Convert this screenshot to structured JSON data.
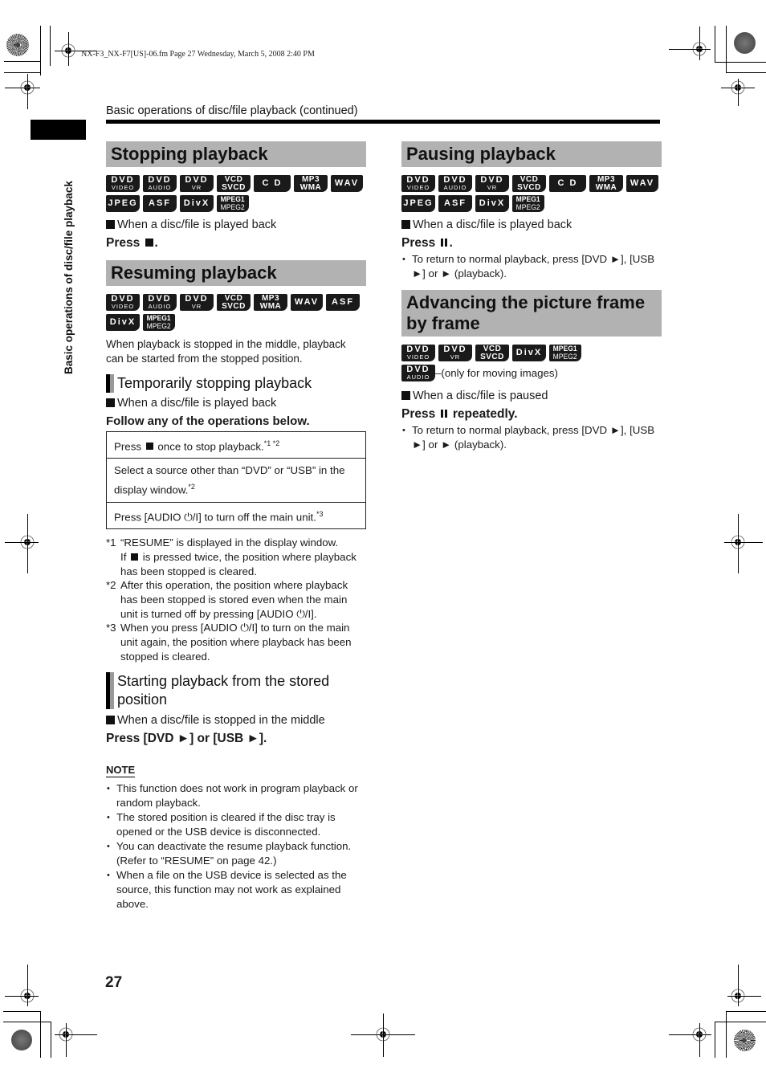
{
  "file_info": "NX-F3_NX-F7[US]-06.fm  Page 27  Wednesday, March 5, 2008  2:40 PM",
  "running_head": "Basic operations of disc/file playback (continued)",
  "side_label": "Basic operations of disc/file playback",
  "page_number": "27",
  "badge_types": {
    "dvd_video": {
      "t1": "DVD",
      "t2": "VIDEO"
    },
    "dvd_audio": {
      "t1": "DVD",
      "t2": "AUDIO"
    },
    "dvd_vr": {
      "t1": "DVD",
      "t2": "VR"
    },
    "vcd_svcd": {
      "t1": "VCD",
      "t2": "SVCD"
    },
    "cd": {
      "t1": "C D"
    },
    "mp3_wma": {
      "t1": "MP3",
      "t2": "WMA"
    },
    "wav": {
      "t1": "WAV"
    },
    "jpeg": {
      "t1": "JPEG"
    },
    "asf": {
      "t1": "ASF"
    },
    "divx": {
      "t1": "DivX"
    },
    "mpeg": {
      "t1": "MPEG1",
      "t2": "MPEG2"
    }
  },
  "stopping": {
    "title": "Stopping playback",
    "badges": [
      "DVD VIDEO",
      "DVD AUDIO",
      "DVD VR",
      "VCD SVCD",
      "CD",
      "MP3 WMA",
      "WAV",
      "JPEG",
      "ASF",
      "DivX",
      "MPEG1 MPEG2"
    ],
    "condition": "When a disc/file is played back",
    "press_prefix": "Press",
    "press_suffix": ".",
    "press_icon": "stop-icon"
  },
  "resuming": {
    "title": "Resuming playback",
    "badges": [
      "DVD VIDEO",
      "DVD AUDIO",
      "DVD VR",
      "VCD SVCD",
      "MP3 WMA",
      "WAV",
      "ASF",
      "DivX",
      "MPEG1 MPEG2"
    ],
    "intro": "When playback is stopped in the middle, playback can be started from the stopped position.",
    "temp_stop": {
      "heading": "Temporarily stopping playback",
      "condition": "When a disc/file is played back",
      "instruction": "Follow any of the operations below.",
      "ops": [
        {
          "pre": "Press",
          "post": "once to stop playback.",
          "sup": "*1 *2"
        },
        {
          "text": "Select a source other than “DVD” or “USB” in the display window.",
          "sup": "*2"
        },
        {
          "text": "Press [AUDIO ⏻/I] to turn off the main unit.",
          "sup": "*3"
        }
      ],
      "footnotes": [
        {
          "mark": "*1",
          "line1": "“RESUME” is displayed in the display window.",
          "line2_pre": "If",
          "line2_post": "is pressed twice, the position where playback has been stopped is cleared."
        },
        {
          "mark": "*2",
          "text": "After this operation, the position where playback has been stopped is stored even when the main unit is turned off by pressing [AUDIO ⏻/I]."
        },
        {
          "mark": "*3",
          "text": "When you press [AUDIO ⏻/I] to turn on the main unit again, the position where playback has been stopped is cleared."
        }
      ]
    },
    "start_stored": {
      "heading": "Starting playback from the stored position",
      "condition": "When a disc/file is stopped in the middle",
      "press": "Press [DVD ►] or [USB ►]."
    },
    "note": {
      "heading": "NOTE",
      "items": [
        "This function does not work in program playback or random playback.",
        "The stored position is cleared if the disc tray is opened or the USB device is disconnected.",
        "You can deactivate the resume playback function. (Refer to “RESUME” on page 42.)",
        "When a file on the USB device is selected as the source, this function may not work as explained above."
      ]
    }
  },
  "pausing": {
    "title": "Pausing playback",
    "badges": [
      "DVD VIDEO",
      "DVD AUDIO",
      "DVD VR",
      "VCD SVCD",
      "CD",
      "MP3 WMA",
      "WAV",
      "JPEG",
      "ASF",
      "DivX",
      "MPEG1 MPEG2"
    ],
    "condition": "When a disc/file is played back",
    "press_prefix": "Press",
    "press_suffix": ".",
    "press_icon": "pause-icon",
    "bullet": "To return to normal playback, press [DVD ►], [USB ►] or ► (playback)."
  },
  "advancing": {
    "title": "Advancing the picture frame by frame",
    "badges": [
      "DVD VIDEO",
      "DVD VR",
      "VCD SVCD",
      "DivX",
      "MPEG1 MPEG2"
    ],
    "extra_badge": "DVD AUDIO",
    "extra_note": "–(only for moving images)",
    "condition": "When a disc/file is paused",
    "press_prefix": "Press",
    "press_suffix": "repeatedly.",
    "press_icon": "pause-icon",
    "bullet": "To return to normal playback, press [DVD ►], [USB ►] or ► (playback)."
  }
}
